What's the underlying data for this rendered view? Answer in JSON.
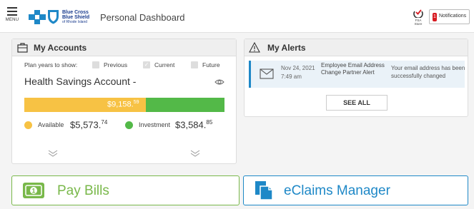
{
  "header": {
    "menu_label": "MENU",
    "logo": {
      "line1": "Blue Cross",
      "line2": "Blue Shield",
      "line3": "of Rhode Island"
    },
    "title": "Personal Dashboard",
    "fsa_label": "FSA Store",
    "notifications": {
      "count": "1",
      "label": "Notifications"
    }
  },
  "accounts": {
    "title": "My Accounts",
    "plan_label": "Plan years to show:",
    "plan_options": [
      {
        "label": "Previous",
        "checked": false
      },
      {
        "label": "Current",
        "checked": true
      },
      {
        "label": "Future",
        "checked": false
      }
    ],
    "account_name": "Health Savings Account -",
    "total_main": "$9,158.",
    "total_cents": "59",
    "available_label": "Available",
    "available_main": "$5,573.",
    "available_cents": "74",
    "investment_label": "Investment",
    "investment_main": "$3,584.",
    "investment_cents": "85",
    "available_fraction": 0.6086,
    "colors": {
      "available": "#f7c244",
      "investment": "#53b948"
    }
  },
  "alerts": {
    "title": "My Alerts",
    "items": [
      {
        "date": "Nov 24, 2021",
        "time": "7:49 am",
        "subject": "Employee Email Address Change Partner Alert",
        "message": "Your email address has been successfully changed"
      }
    ],
    "see_all": "SEE ALL"
  },
  "tiles": {
    "pay_bills": "Pay Bills",
    "eclaims": "eClaims Manager",
    "colors": {
      "pay_bills": "#79b84a",
      "eclaims": "#1e88c7"
    }
  },
  "icons": [
    "menu-icon",
    "cross-icon",
    "shield-icon",
    "fsa-store-icon",
    "briefcase-icon",
    "warning-icon",
    "eye-icon",
    "chevron-down-icon",
    "envelope-icon",
    "money-icon",
    "document-icon"
  ]
}
